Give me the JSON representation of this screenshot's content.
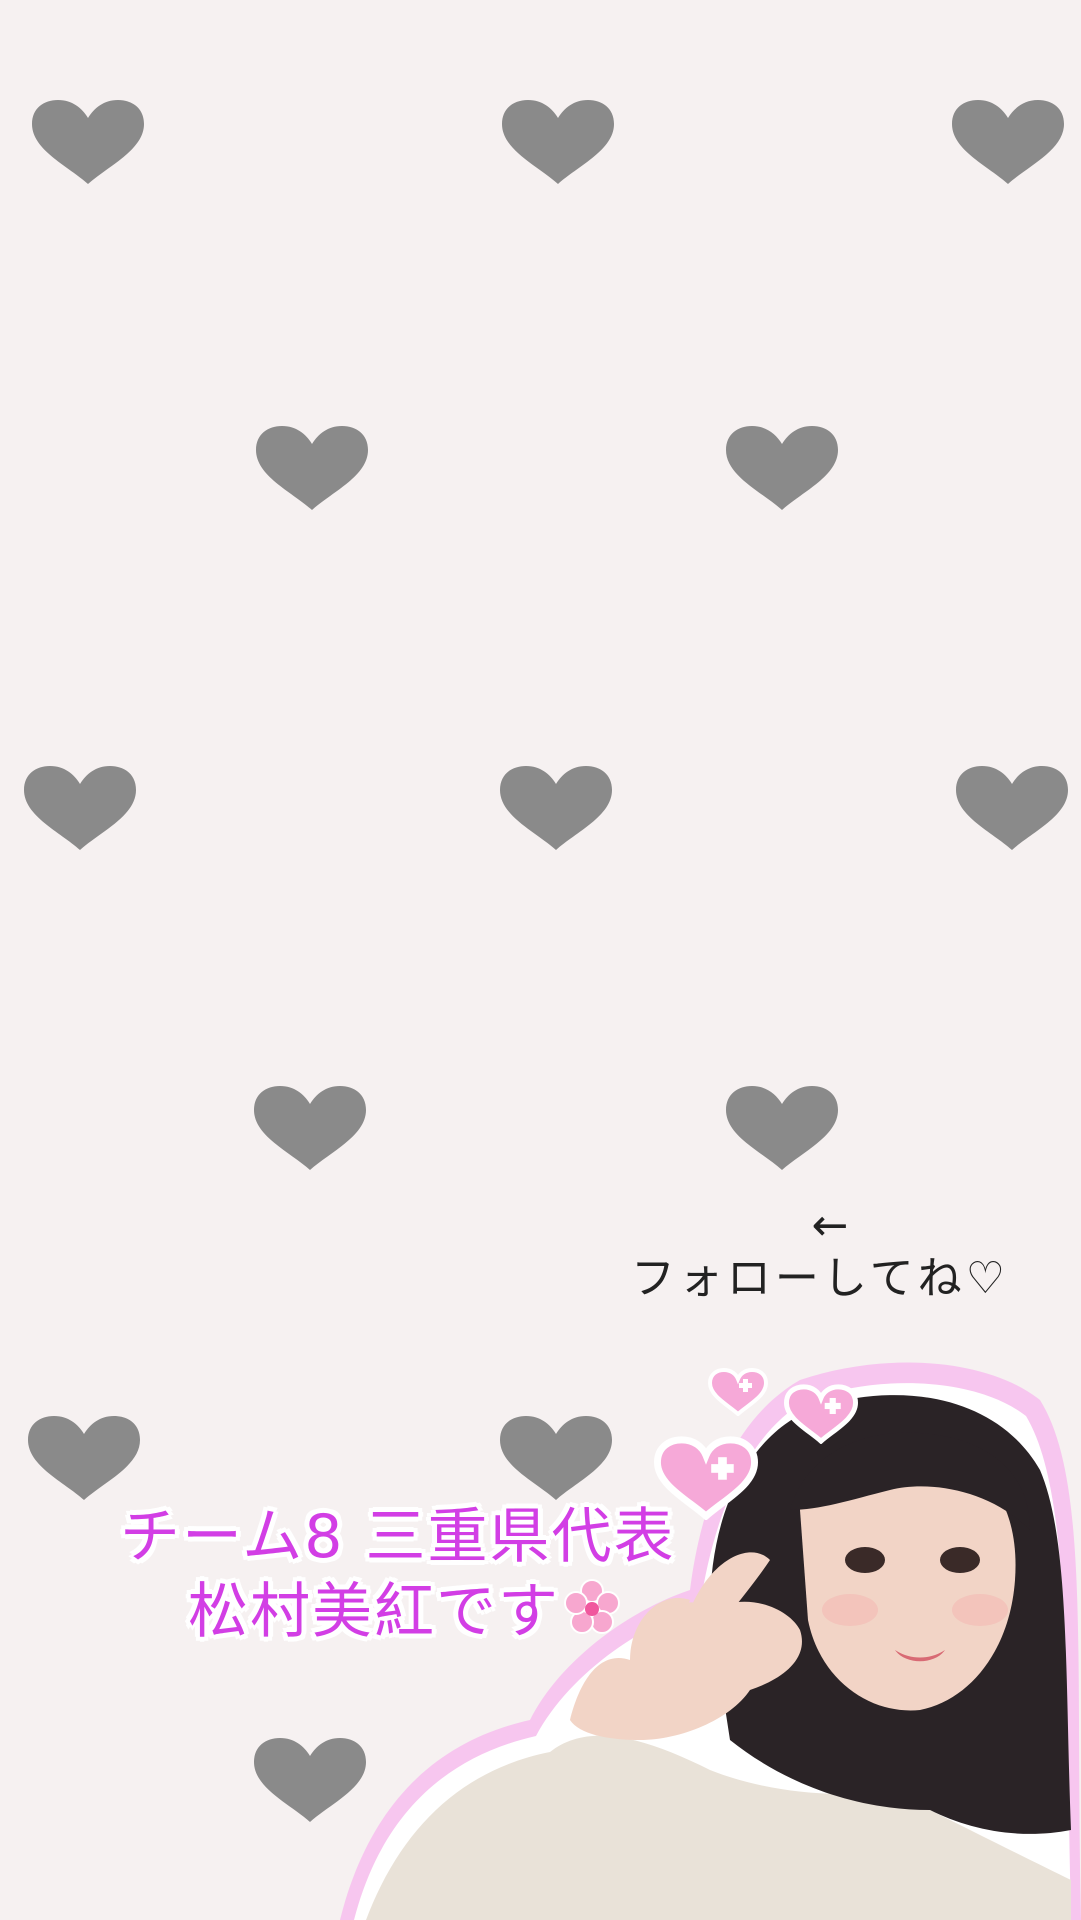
{
  "background_color": "#f6f1f1",
  "heart_color": "#8a8a8a",
  "accent_color": "#d23ee5",
  "follow": {
    "arrow": "←",
    "text": "フォローしてね♡"
  },
  "caption": {
    "line1": "チーム8 三重県代表",
    "line2": "松村美紅です"
  },
  "icons": [
    "heart-icon",
    "pink-pixel-heart-icon",
    "cherry-blossom-icon"
  ]
}
